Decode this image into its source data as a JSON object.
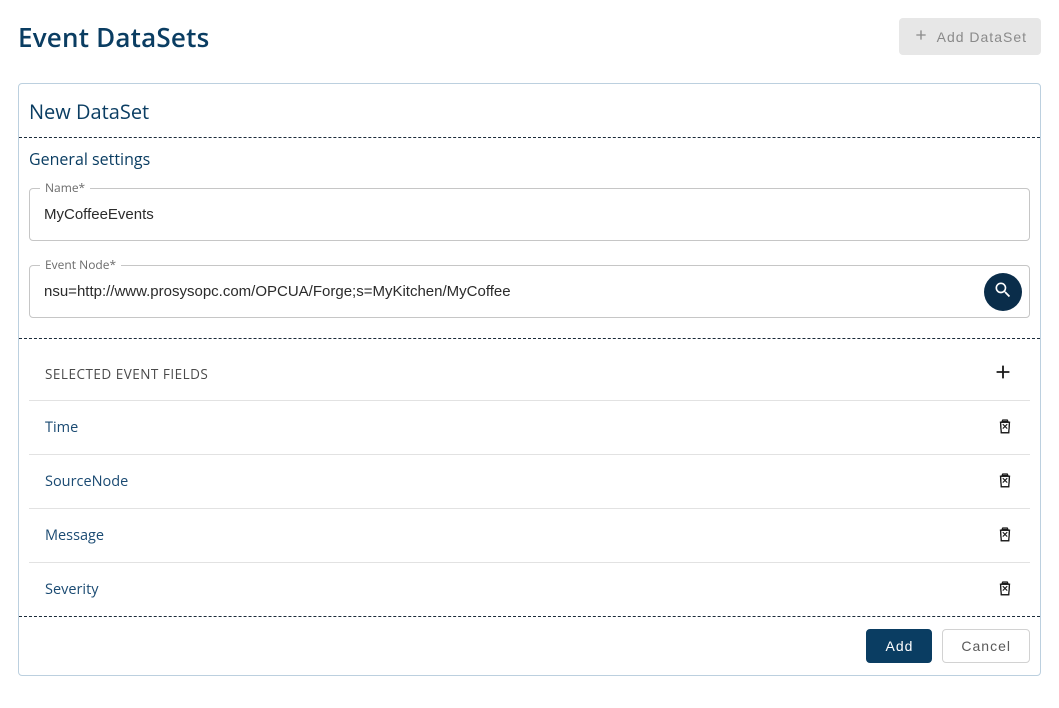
{
  "header": {
    "title": "Event DataSets",
    "add_button_label": "Add DataSet"
  },
  "panel": {
    "title": "New DataSet"
  },
  "general": {
    "section_title": "General settings",
    "name_label": "Name*",
    "name_value": "MyCoffeeEvents",
    "event_node_label": "Event Node*",
    "event_node_value": "nsu=http://www.prosysopc.com/OPCUA/Forge;s=MyKitchen/MyCoffee"
  },
  "selected_fields": {
    "header": "SELECTED EVENT FIELDS",
    "items": [
      "Time",
      "SourceNode",
      "Message",
      "Severity"
    ]
  },
  "footer": {
    "add_label": "Add",
    "cancel_label": "Cancel"
  }
}
